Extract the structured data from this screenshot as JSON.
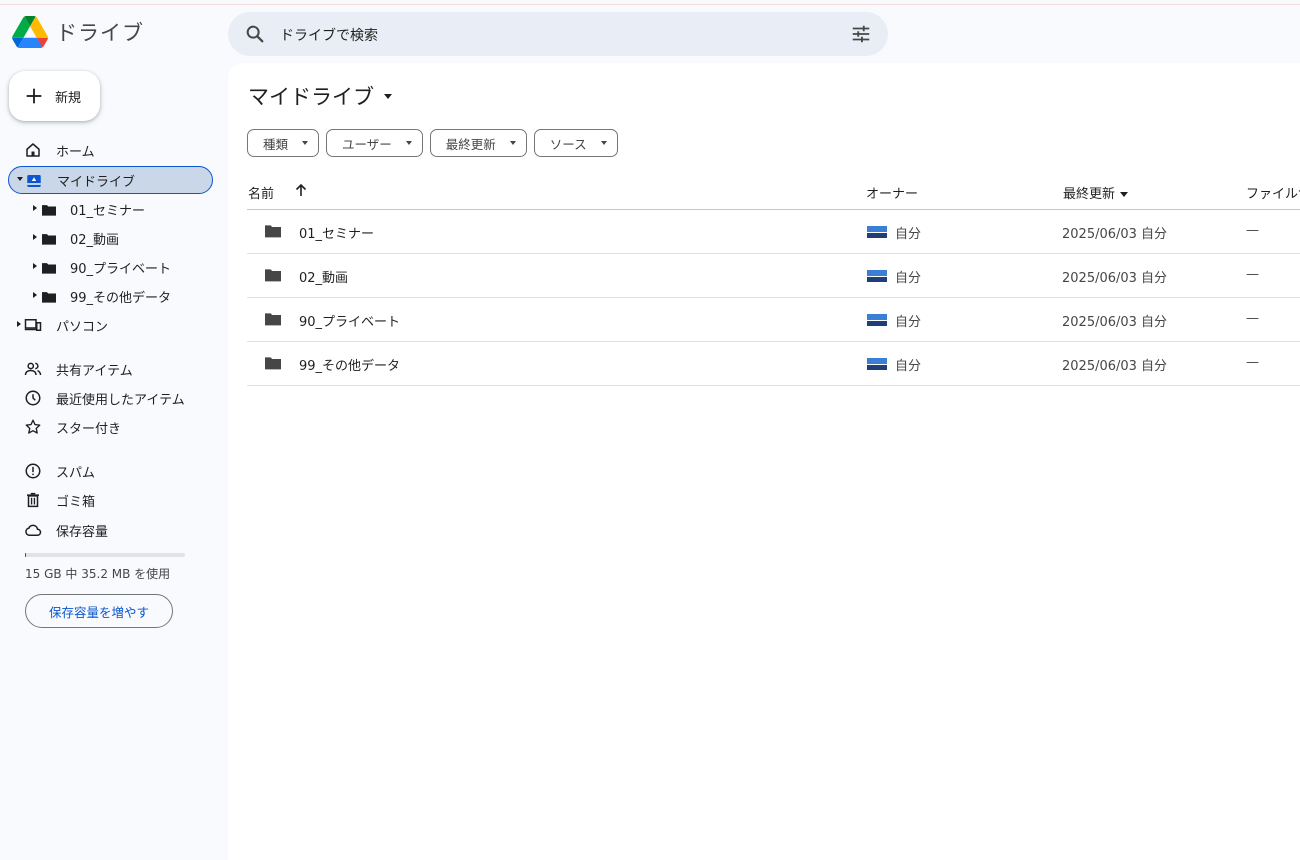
{
  "app": {
    "title": "ドライブ"
  },
  "search": {
    "placeholder": "ドライブで検索"
  },
  "sidebar": {
    "new_label": "新規",
    "items": [
      {
        "label": "ホーム"
      },
      {
        "label": "マイドライブ"
      },
      {
        "label": "パソコン"
      },
      {
        "label": "共有アイテム"
      },
      {
        "label": "最近使用したアイテム"
      },
      {
        "label": "スター付き"
      },
      {
        "label": "スパム"
      },
      {
        "label": "ゴミ箱"
      },
      {
        "label": "保存容量"
      }
    ],
    "folders": [
      {
        "label": "01_セミナー"
      },
      {
        "label": "02_動画"
      },
      {
        "label": "90_プライベート"
      },
      {
        "label": "99_その他データ"
      }
    ],
    "storage_text": "15 GB 中 35.2 MB を使用",
    "storage_used_fraction": 0.0023,
    "more_storage_label": "保存容量を増やす"
  },
  "main": {
    "title": "マイドライブ",
    "filters": [
      "種類",
      "ユーザー",
      "最終更新",
      "ソース"
    ],
    "columns": {
      "name": "名前",
      "owner": "オーナー",
      "modified": "最終更新",
      "size": "ファイルサ"
    },
    "rows": [
      {
        "name": "01_セミナー",
        "owner": "自分",
        "modified": "2025/06/03 自分",
        "size": "—"
      },
      {
        "name": "02_動画",
        "owner": "自分",
        "modified": "2025/06/03 自分",
        "size": "—"
      },
      {
        "name": "90_プライベート",
        "owner": "自分",
        "modified": "2025/06/03 自分",
        "size": "—"
      },
      {
        "name": "99_その他データ",
        "owner": "自分",
        "modified": "2025/06/03 自分",
        "size": "—"
      }
    ]
  },
  "colors": {
    "accent": "#0b57d0",
    "selected": "#c9d7e8",
    "search_bg": "#e9eef6",
    "page_bg": "#f8fafd"
  }
}
